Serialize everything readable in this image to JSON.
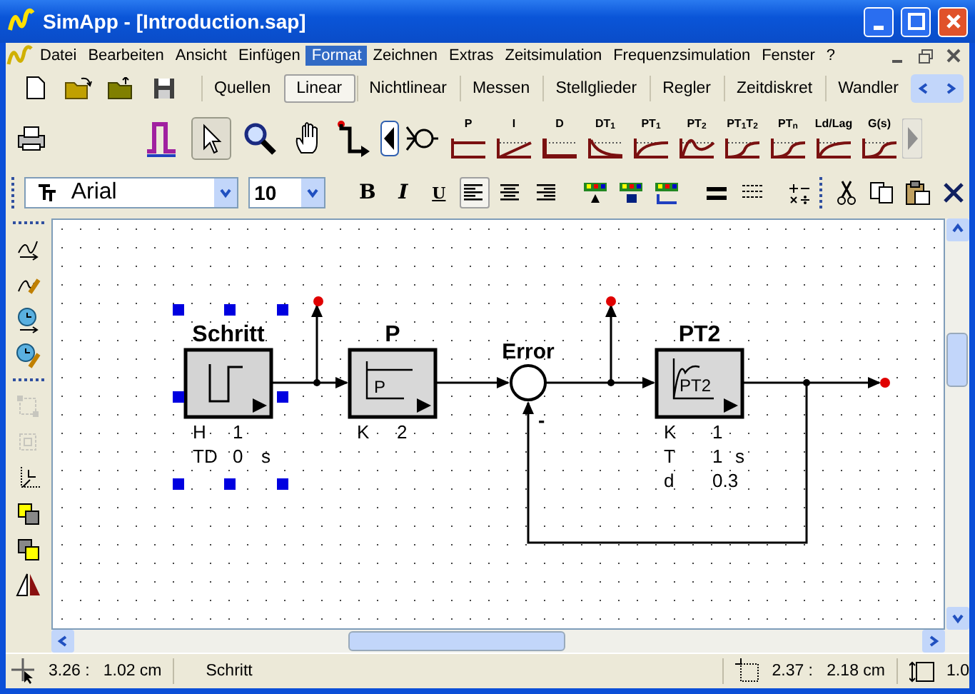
{
  "window": {
    "title": "SimApp - [Introduction.sap]"
  },
  "menu": [
    {
      "label": "Datei",
      "selected": false
    },
    {
      "label": "Bearbeiten",
      "selected": false
    },
    {
      "label": "Ansicht",
      "selected": false
    },
    {
      "label": "Einfügen",
      "selected": false
    },
    {
      "label": "Format",
      "selected": true
    },
    {
      "label": "Zeichnen",
      "selected": false
    },
    {
      "label": "Extras",
      "selected": false
    },
    {
      "label": "Zeitsimulation",
      "selected": false
    },
    {
      "label": "Frequenzsimulation",
      "selected": false
    },
    {
      "label": "Fenster",
      "selected": false
    },
    {
      "label": "?",
      "selected": false
    }
  ],
  "tabs": [
    {
      "label": "Quellen",
      "selected": false
    },
    {
      "label": "Linear",
      "selected": true
    },
    {
      "label": "Nichtlinear",
      "selected": false
    },
    {
      "label": "Messen",
      "selected": false
    },
    {
      "label": "Stellglieder",
      "selected": false
    },
    {
      "label": "Regler",
      "selected": false
    },
    {
      "label": "Zeitdiskret",
      "selected": false
    },
    {
      "label": "Wandler",
      "selected": false
    }
  ],
  "tools": [
    {
      "kind": "pointer",
      "selected": true
    },
    {
      "kind": "zoom",
      "selected": false
    },
    {
      "kind": "hand",
      "selected": false
    }
  ],
  "palette": [
    {
      "label": "P",
      "kind": "flat"
    },
    {
      "label": "I",
      "kind": "ramp"
    },
    {
      "label": "D",
      "kind": "impulse"
    },
    {
      "label": "DT$_{1}$",
      "kind": "decay"
    },
    {
      "label": "PT$_{1}$",
      "kind": "rise"
    },
    {
      "label": "PT$_{2}$",
      "kind": "osc"
    },
    {
      "label": "PT$_{1}$T$_{2}$",
      "kind": "s"
    },
    {
      "label": "PT$_{n}$",
      "kind": "s"
    },
    {
      "label": "Ld/Lag",
      "kind": "rise"
    },
    {
      "label": "G(s)",
      "kind": "s"
    }
  ],
  "format": {
    "font": "Arial",
    "size": "10",
    "styles": [
      "B",
      "I",
      "U"
    ],
    "align": [
      {
        "kind": "left",
        "selected": true
      },
      {
        "kind": "center",
        "selected": false
      },
      {
        "kind": "right",
        "selected": false
      }
    ]
  },
  "side_tools": [
    {
      "kind": "curve",
      "disabled": false
    },
    {
      "kind": "curve-edit",
      "disabled": false
    },
    {
      "kind": "clock",
      "disabled": false
    },
    {
      "kind": "clock-edit",
      "disabled": false
    },
    {
      "kind": "group",
      "disabled": true
    },
    {
      "kind": "ungroup",
      "disabled": true
    },
    {
      "kind": "origin",
      "disabled": false
    },
    {
      "kind": "front",
      "disabled": false
    },
    {
      "kind": "back",
      "disabled": false
    },
    {
      "kind": "mirror",
      "disabled": false
    }
  ],
  "diagram": {
    "blocks": [
      {
        "title": "Schritt",
        "kind": "step",
        "params": [
          [
            "H",
            "1"
          ],
          [
            "TD",
            "0",
            "s"
          ]
        ],
        "selected": true
      },
      {
        "title": "P",
        "kind": "gain",
        "icon_text": "P",
        "params": [
          [
            "K",
            "2"
          ]
        ],
        "selected": false
      },
      {
        "title": "PT2",
        "kind": "pt2",
        "icon_text": "PT2",
        "params": [
          [
            "K",
            "1"
          ],
          [
            "T",
            "1",
            "s"
          ],
          [
            "d",
            "0.3"
          ]
        ],
        "selected": false
      }
    ],
    "sum": {
      "title": "Error",
      "sign": "-"
    }
  },
  "status": {
    "position": "3.26 :   1.02 cm",
    "object": "Schritt",
    "size": "2.37 :   2.18 cm",
    "extra": "1.0"
  }
}
